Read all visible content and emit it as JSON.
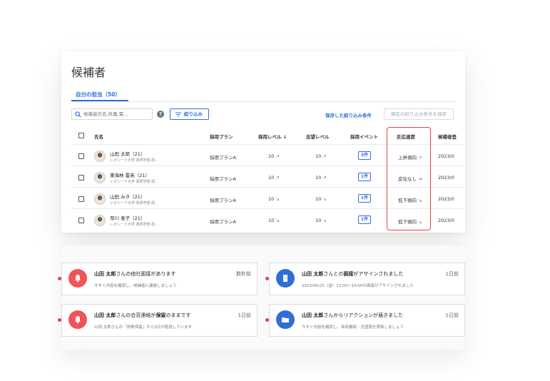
{
  "page": {
    "title": "候補者"
  },
  "tabs": [
    {
      "label": "自分の担当（50）"
    }
  ],
  "toolbar": {
    "search_placeholder": "候補者氏名,所属,電…",
    "help": "?",
    "filter_label": "絞り込み",
    "saved_filters_link": "保存した絞り込み条件",
    "save_filter_button": "現在の絞り込み条件を保存"
  },
  "table": {
    "headers": [
      "氏名",
      "採用プラン",
      "採用レベル ↓",
      "志望レベル",
      "採用イベント",
      "反応速度",
      "候補者登"
    ],
    "rows": [
      {
        "name": "山田 太郎（21）",
        "school": "レガシード大学 政邦学部 政…",
        "plan": "採用プランA",
        "hire_level": "10",
        "hire_trend": "↗",
        "aspire_level": "10",
        "aspire_trend": "↗",
        "events": "3件",
        "speed": "上昇傾向",
        "speed_trend": "↗",
        "date": "2023/0"
      },
      {
        "name": "東海林 雷英（21）",
        "school": "レガシード大学 政邦学部 政…",
        "plan": "採用プランA",
        "hire_level": "10",
        "hire_trend": "↗",
        "aspire_level": "10",
        "aspire_trend": "↗",
        "events": "1件",
        "speed": "変化なし",
        "speed_trend": "→",
        "date": "2023/0"
      },
      {
        "name": "山田 みき（21）",
        "school": "レガシード大学 政邦学部 政…",
        "plan": "採用プランA",
        "hire_level": "10",
        "hire_trend": "↘",
        "aspire_level": "10",
        "aspire_trend": "↘",
        "events": "1件",
        "speed": "低下傾向",
        "speed_trend": "↘",
        "date": "2023/0"
      },
      {
        "name": "早川 恵子（21）",
        "school": "レガシード大学 政邦学部 政…",
        "plan": "採用プランA",
        "hire_level": "10",
        "hire_trend": "↘",
        "aspire_level": "10",
        "aspire_trend": "↘",
        "events": "1件",
        "speed": "低下傾向",
        "speed_trend": "↘",
        "date": "2023/0"
      }
    ]
  },
  "notifications": [
    {
      "name": "山田 太郎",
      "title_rest": "さんの他社面接があります",
      "time": "数秒前",
      "body": "今すぐ内容を確認し、候補者に連絡しましょう",
      "icon": "bell-icon",
      "color": "#f0535a"
    },
    {
      "name": "山田 太郎",
      "title_mid": "さんとの",
      "title_bold": "面接",
      "title_rest": "がアサインされました",
      "time": "1日前",
      "body": "2023/06/23（金）13:00～14:00の面接がアサインされました",
      "icon": "door-icon",
      "color": "#2f6fd6"
    },
    {
      "name": "山田 太郎",
      "title_mid": "さんの合否連絡が",
      "title_bold": "保留",
      "title_rest": "のままです",
      "time": "1日前",
      "body": "山田 太郎さんの「判断保留」から3日が経過しています",
      "icon": "bell-icon",
      "color": "#f0535a"
    },
    {
      "name": "山田 太郎",
      "title_rest": "さんからリアクションが届きました",
      "time": "1日前",
      "body": "今すぐ内容を確認し、採用書紙・志望度を更新しましょう",
      "icon": "folder-icon",
      "color": "#2f6fd6"
    }
  ]
}
